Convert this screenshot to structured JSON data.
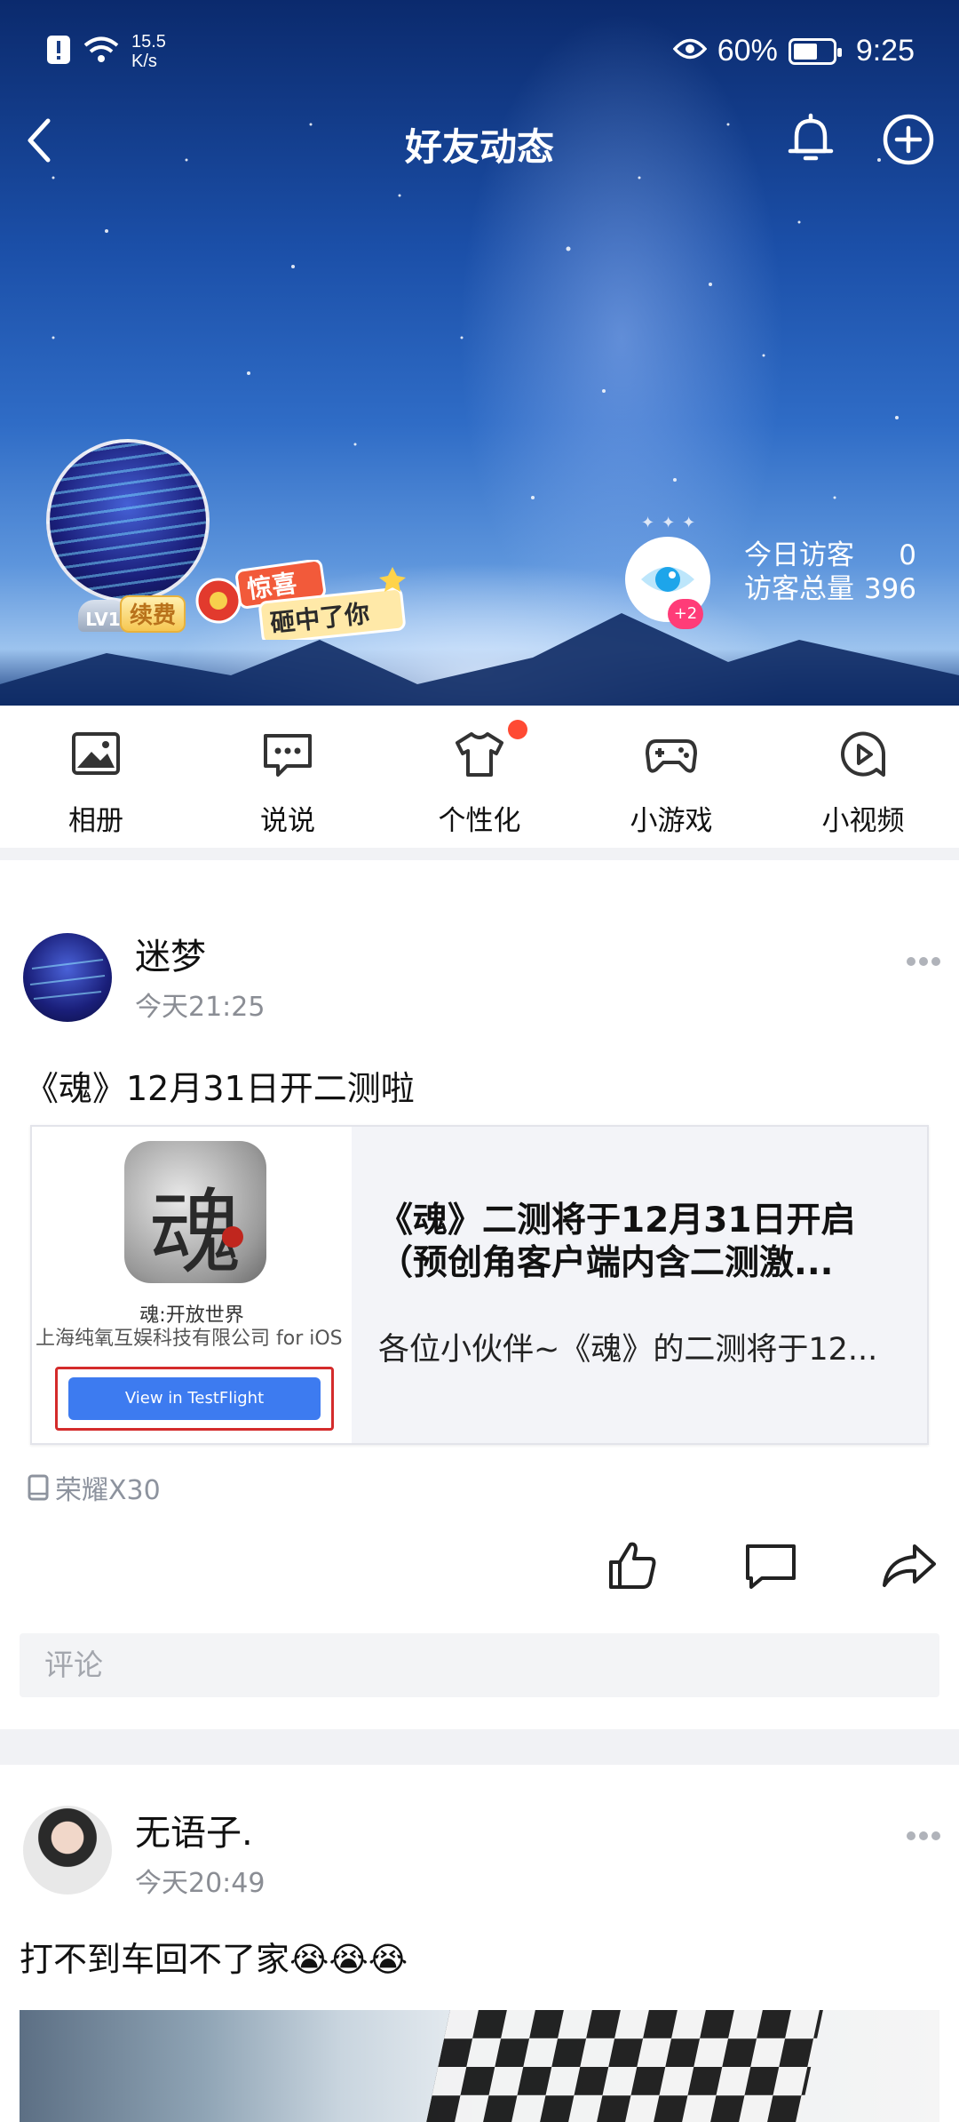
{
  "status_bar": {
    "net_speed_top": "15.5",
    "net_speed_bottom": "K/s",
    "battery": "60%",
    "time": "9:25"
  },
  "nav": {
    "title": "好友动态"
  },
  "profile": {
    "level": "LV1",
    "renew_label": "续费",
    "surprise_text_1": "惊喜",
    "surprise_text_2": "砸中了你",
    "visitor_plus": "+2",
    "today_visitors_label": "今日访客",
    "today_visitors": "0",
    "total_visitors_label": "访客总量",
    "total_visitors": "396"
  },
  "shortcuts": [
    {
      "label": "相册",
      "icon": "photo-album-icon"
    },
    {
      "label": "说说",
      "icon": "message-bubble-icon"
    },
    {
      "label": "个性化",
      "icon": "tshirt-icon"
    },
    {
      "label": "小游戏",
      "icon": "gamepad-icon"
    },
    {
      "label": "小视频",
      "icon": "video-play-icon"
    }
  ],
  "posts": [
    {
      "name": "迷梦",
      "time": "今天21:25",
      "text": "《魂》12月31日开二测啦",
      "card": {
        "thumb_title": "魂:开放世界",
        "thumb_company": "上海纯氧互娱科技有限公司 for iOS",
        "thumb_button": "View in TestFlight",
        "icon_glyph": "魂",
        "title": "《魂》二测将于12月31日开启（预创角客户端内含二测激...",
        "desc": "各位小伙伴~《魂》的二测将于12..."
      },
      "device": "荣耀X30",
      "comment_placeholder": "评论"
    },
    {
      "name": "无语子.",
      "time": "今天20:49",
      "text": "打不到车回不了家😭😭😭"
    }
  ],
  "colors": {
    "accent_red": "#ff4a33",
    "badge_pink": "#ff3c78",
    "link_blue": "#3d7bf0"
  }
}
